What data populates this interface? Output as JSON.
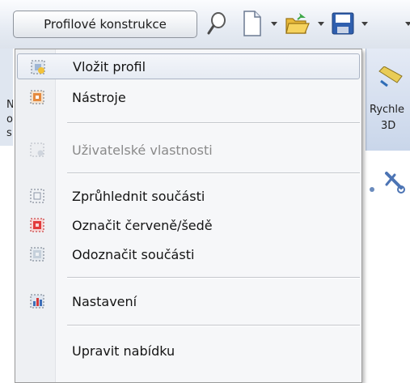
{
  "toolbar": {
    "profile_button_label": "Profilové konstrukce"
  },
  "background": {
    "side_letters": [
      "N",
      "ol",
      "s"
    ],
    "ribbon_label_1": "Rychle",
    "ribbon_label_2": "3D"
  },
  "menu": {
    "items": [
      {
        "label": "Vložit profil",
        "icon": "insert-profile-icon",
        "highlighted": true
      },
      {
        "label": "Nástroje",
        "icon": "tools-icon"
      },
      {
        "label": "Uživatelské vlastnosti",
        "icon": "user-properties-icon",
        "disabled": true
      },
      {
        "label": "Zprůhlednit součásti",
        "icon": "transparent-parts-icon"
      },
      {
        "label": "Označit červeně/šedě",
        "icon": "mark-red-gray-icon"
      },
      {
        "label": "Odoznačit součásti",
        "icon": "unmark-parts-icon"
      },
      {
        "label": "Nastavení",
        "icon": "settings-icon"
      },
      {
        "label": "Upravit nabídku",
        "icon": ""
      }
    ]
  }
}
